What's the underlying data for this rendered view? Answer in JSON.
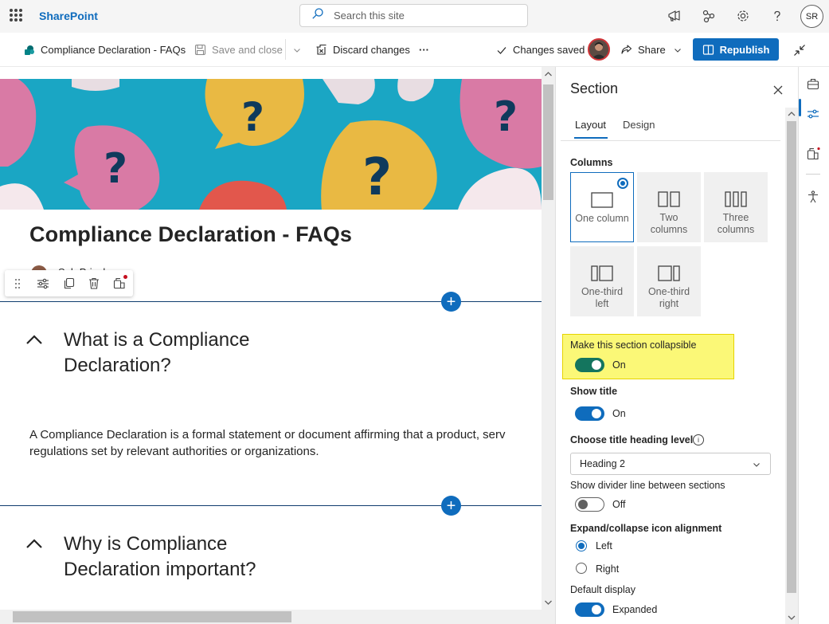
{
  "suite": {
    "brand": "SharePoint",
    "search_placeholder": "Search this site",
    "user_initials": "SR"
  },
  "command_bar": {
    "page_name": "Compliance Declaration - FAQs",
    "save_close_label": "Save and close",
    "discard_label": "Discard changes",
    "more_label": "···",
    "status": "Changes saved",
    "share_label": "Share",
    "republish_label": "Republish"
  },
  "canvas": {
    "page_title": "Compliance Declaration - FAQs",
    "author": "Sab   Prinsk",
    "sections": [
      {
        "title_line1": "What is a Compliance",
        "title_line2": "Declaration?",
        "body_line1": "A Compliance Declaration is a formal statement or document affirming that a product, serv",
        "body_line2": "regulations set by relevant authorities or organizations."
      },
      {
        "title_line1": "Why is Compliance",
        "title_line2": "Declaration important?"
      }
    ],
    "add_section_symbol": "+"
  },
  "pane": {
    "title": "Section",
    "tabs": [
      {
        "label": "Layout",
        "active": true
      },
      {
        "label": "Design",
        "active": false
      }
    ],
    "columns_label": "Columns",
    "column_options": [
      {
        "line1": "One column",
        "line2": "",
        "selected": true
      },
      {
        "line1": "Two",
        "line2": "columns",
        "selected": false
      },
      {
        "line1": "Three",
        "line2": "columns",
        "selected": false
      },
      {
        "line1": "One-third",
        "line2": "left",
        "selected": false
      },
      {
        "line1": "One-third",
        "line2": "right",
        "selected": false
      }
    ],
    "collapsible": {
      "label": "Make this section collapsible",
      "state": "On",
      "on": true
    },
    "show_title": {
      "label": "Show title",
      "state": "On",
      "on": true
    },
    "heading_level": {
      "label": "Choose title heading level",
      "info": "i",
      "value": "Heading 2"
    },
    "divider": {
      "label": "Show divider line between sections",
      "state": "Off",
      "on": false
    },
    "alignment": {
      "label": "Expand/collapse icon alignment",
      "options": [
        {
          "label": "Left",
          "checked": true
        },
        {
          "label": "Right",
          "checked": false
        }
      ]
    },
    "default_display": {
      "label": "Default display",
      "state": "Expanded",
      "on": true
    }
  },
  "colors": {
    "accent": "#0f6cbd",
    "collapsible_toggle": "#14755e",
    "highlight": "#fbf877",
    "hero_background": "#1aa6c4"
  },
  "icons": {
    "suite": [
      "waffle-icon",
      "search-icon",
      "megaphone-icon",
      "share-network-icon",
      "gear-icon",
      "help-icon"
    ],
    "rail": [
      "toolbox-icon",
      "properties-icon",
      "page-design-icon",
      "accessibility-icon"
    ]
  }
}
